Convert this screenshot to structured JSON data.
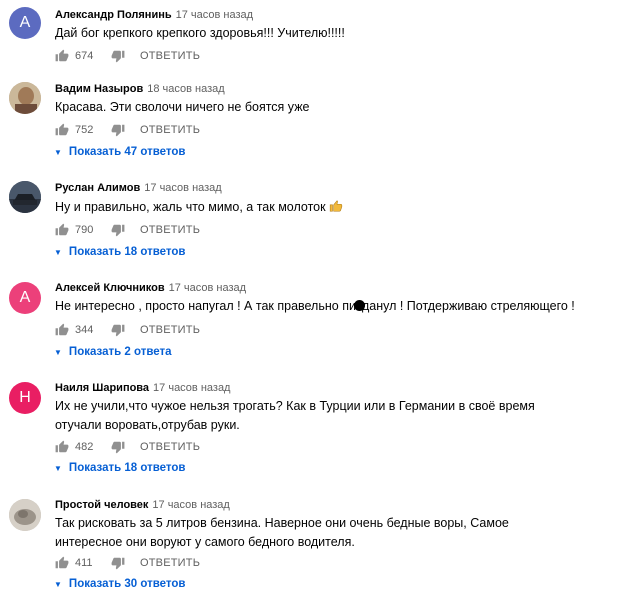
{
  "reply_label": "ОТВЕТИТЬ",
  "colors": {
    "link": "#065fd4",
    "meta": "#606060"
  },
  "comments": [
    {
      "author": "Александр Полянинь",
      "time": "17 часов назад",
      "avatar_letter": "А",
      "avatar_color": "#5c6bc0",
      "text": "Дай бог крепкого крепкого здоровья!!! Учителю!!!!!",
      "likes": "674"
    },
    {
      "author": "Вадим Назыров",
      "time": "18 часов назад",
      "avatar_icon": "photo-avatar",
      "text": "Красава. Эти сволочи ничего не боятся уже",
      "likes": "752",
      "replies": "Показать 47 ответов"
    },
    {
      "author": "Руслан Алимов",
      "time": "17 часов назад",
      "avatar_icon": "car-photo-avatar",
      "text": "Ну и правильно, жаль что мимо, а так молоток",
      "emoji": "thumbs-up-emoji",
      "likes": "790",
      "replies": "Показать 18 ответов"
    },
    {
      "author": "Алексей Ключников",
      "time": "17 часов назад",
      "avatar_letter": "А",
      "avatar_color": "#ec407a",
      "text_before": "Не интересно , просто напугал ! А так правельно пи",
      "text_after": "данул ! Потдерживаю стреляющего !",
      "likes": "344",
      "replies": "Показать 2 ответа"
    },
    {
      "author": "Наиля Шарипова",
      "time": "17 часов назад",
      "avatar_letter": "Н",
      "avatar_color": "#e91e63",
      "text": "Их не учили,что чужое нельзя трогать? Как в Турции или в Германии в своё время отучали воровать,отрубав руки.",
      "likes": "482",
      "replies": "Показать 18 ответов"
    },
    {
      "author": "Простой человек",
      "time": "17 часов назад",
      "avatar_icon": "photo-avatar",
      "text": "Так рисковать за 5 литров бензина. Наверное они очень бедные воры, Самое интересное они воруют у самого бедного водителя.",
      "likes": "411",
      "replies": "Показать 30 ответов"
    }
  ]
}
